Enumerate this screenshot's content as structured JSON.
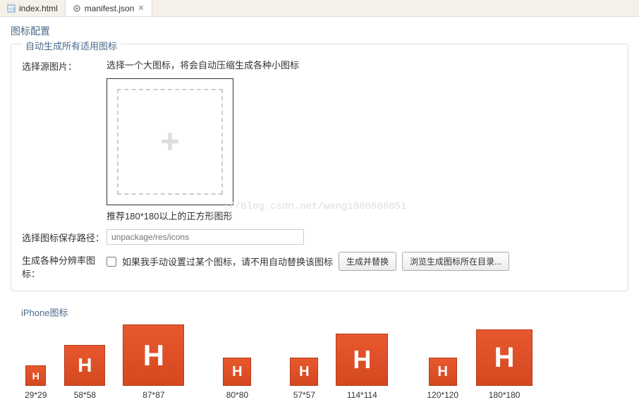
{
  "tabs": [
    {
      "label": "index.html",
      "active": false
    },
    {
      "label": "manifest.json",
      "active": true
    }
  ],
  "page_title": "图标配置",
  "section1": {
    "title": "自动生成所有适用图标",
    "select_source_label": "选择源图片：",
    "select_source_hint": "选择一个大图标，将会自动压缩生成各种小图标",
    "image_hint": "推荐180*180以上的正方形图形",
    "save_path_label": "选择图标保存路径：",
    "save_path_placeholder": "unpackage/res/icons",
    "gen_label": "生成各种分辨率图标：",
    "checkbox_label": "如果我手动设置过某个图标，请不用自动替换该图标",
    "btn_generate": "生成并替换",
    "btn_browse": "浏览生成图标所在目录...",
    "plus": "+",
    "watermark": "://blog.csdn.net/wang1006008051"
  },
  "iphone": {
    "title": "iPhone图标",
    "icons": [
      {
        "label": "29*29",
        "cls": "size-29"
      },
      {
        "label": "58*58",
        "cls": "size-58"
      },
      {
        "label": "87*87",
        "cls": "size-87"
      },
      {
        "label": "80*80",
        "cls": "size-40"
      },
      {
        "label": "57*57",
        "cls": "size-40"
      },
      {
        "label": "114*114",
        "cls": "size-114"
      },
      {
        "label": "120*120",
        "cls": "size-40"
      },
      {
        "label": "180*180",
        "cls": "size-180"
      }
    ],
    "icon_letter": "H"
  }
}
